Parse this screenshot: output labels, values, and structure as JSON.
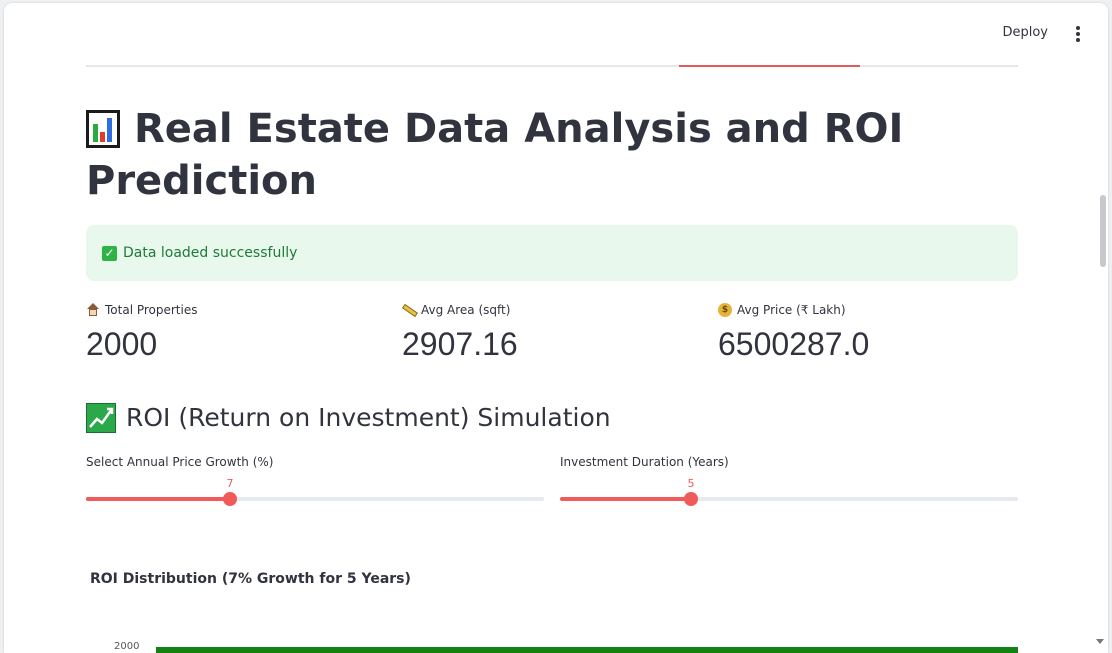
{
  "header": {
    "deploy_label": "Deploy"
  },
  "title": {
    "text": "Real Estate Data Analysis and ROI Prediction",
    "icon": "bar-chart-icon"
  },
  "alert": {
    "text": "Data loaded successfully",
    "icon": "check-mark-icon",
    "color": "#e8f8ec"
  },
  "metrics": [
    {
      "label": "Total Properties",
      "value": "2000",
      "icon": "house-icon"
    },
    {
      "label": "Avg Area (sqft)",
      "value": "2907.16",
      "icon": "ruler-icon"
    },
    {
      "label": "Avg Price (₹ Lakh)",
      "value": "6500287.0",
      "icon": "money-bag-icon"
    }
  ],
  "roi_section": {
    "title": "ROI (Return on Investment) Simulation",
    "icon": "chart-increasing-icon"
  },
  "sliders": [
    {
      "label": "Select Annual Price Growth (%)",
      "value": "7",
      "fraction": 0.315
    },
    {
      "label": "Investment Duration (Years)",
      "value": "5",
      "fraction": 0.285
    }
  ],
  "chart": {
    "title": "ROI Distribution (7% Growth for 5 Years)",
    "bar_color": "#128212"
  },
  "chart_data": {
    "type": "bar",
    "title": "ROI Distribution (7% Growth for 5 Years)",
    "ytick_labels": [
      "2000"
    ]
  },
  "colors": {
    "accent": "#f05a58",
    "success_text": "#1f7a38"
  }
}
